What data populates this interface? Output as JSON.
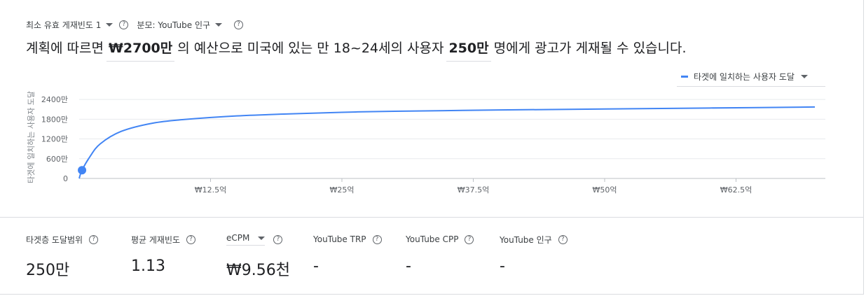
{
  "filters": {
    "frequency_label": "최소 유효 게재빈도 1",
    "denominator_label": "분모: YouTube 인구"
  },
  "sentence": {
    "part1": "계획에 따르면",
    "budget": "₩2700만",
    "part2": "의 예산으로 미국에 있는 만 18~24세의 사용자",
    "reach": "250만",
    "part3": "명에게 광고가 게재될 수 있습니다."
  },
  "legend": {
    "label": "타겟에 일치하는 사용자 도달",
    "color": "#4285f4"
  },
  "chart_data": {
    "type": "line",
    "ylabel": "타겟에 일치하는 사용자 도달",
    "y_ticks": [
      "0",
      "600만",
      "1200만",
      "1800만",
      "2400만"
    ],
    "y_tick_values": [
      0,
      6000000,
      12000000,
      18000000,
      24000000
    ],
    "x_ticks": [
      "₩12.5억",
      "₩25억",
      "₩37.5억",
      "₩50억",
      "₩62.5억"
    ],
    "x_tick_values": [
      1250000000,
      2500000000,
      3750000000,
      5000000000,
      6250000000
    ],
    "xlim": [
      0,
      7100000000
    ],
    "ylim": [
      0,
      27000000
    ],
    "grid": true,
    "series": [
      {
        "name": "타겟에 일치하는 사용자 도달",
        "x": [
          0,
          27000000,
          100000000,
          200000000,
          400000000,
          700000000,
          1000000000,
          1500000000,
          2000000000,
          2500000000,
          3000000000,
          4000000000,
          5000000000,
          6000000000,
          7000000000
        ],
        "y": [
          0,
          2500000,
          6500000,
          10500000,
          14300000,
          16800000,
          17900000,
          19000000,
          19600000,
          20100000,
          20400000,
          20800000,
          21100000,
          21400000,
          21700000
        ]
      }
    ],
    "highlight_point": {
      "x": 27000000,
      "y": 2500000
    }
  },
  "metrics": [
    {
      "label": "타겟층 도달범위",
      "value": "250만",
      "has_help": true,
      "dropdown": false
    },
    {
      "label": "평균 게재빈도",
      "value": "1.13",
      "has_help": true,
      "dropdown": false
    },
    {
      "label": "eCPM",
      "value": "₩9.56천",
      "has_help": true,
      "dropdown": true
    },
    {
      "label": "YouTube TRP",
      "value": "-",
      "has_help": true,
      "dropdown": false
    },
    {
      "label": "YouTube CPP",
      "value": "-",
      "has_help": true,
      "dropdown": false
    },
    {
      "label": "YouTube 인구",
      "value": "-",
      "has_help": true,
      "dropdown": false
    }
  ]
}
